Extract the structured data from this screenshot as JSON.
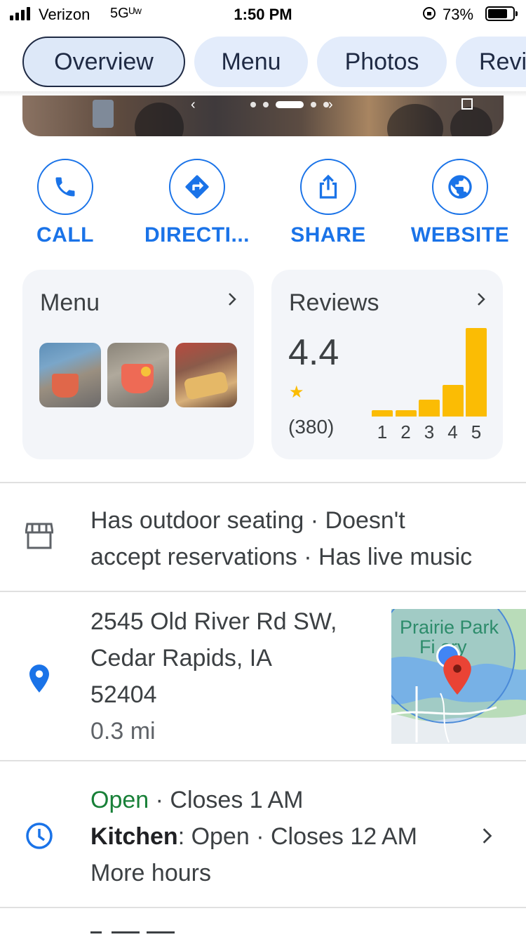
{
  "status_bar": {
    "carrier": "Verizon",
    "network": "5Gᵁʷ",
    "time": "1:50 PM",
    "battery_pct": "73%",
    "battery_level": 0.73
  },
  "tabs": [
    {
      "label": "Overview",
      "active": true
    },
    {
      "label": "Menu",
      "active": false
    },
    {
      "label": "Photos",
      "active": false
    },
    {
      "label": "Revi",
      "active": false
    }
  ],
  "photo_carousel": {
    "dots": 6,
    "active_index": 2
  },
  "actions": [
    {
      "label": "CALL",
      "icon": "phone-icon"
    },
    {
      "label": "DIRECTI...",
      "icon": "directions-icon"
    },
    {
      "label": "SHARE",
      "icon": "share-icon"
    },
    {
      "label": "WEBSITE",
      "icon": "globe-icon"
    }
  ],
  "menu_card": {
    "title": "Menu",
    "thumbnails": [
      "drink-photo",
      "cocktail-photo",
      "food-photo"
    ]
  },
  "reviews_card": {
    "title": "Reviews",
    "rating": "4.4",
    "stars": 1,
    "count": "(380)",
    "bar_labels": [
      "1",
      "2",
      "3",
      "4",
      "5"
    ],
    "distribution": [
      0.07,
      0.07,
      0.19,
      0.36,
      1.0
    ]
  },
  "attributes": {
    "line1": "Has outdoor seating · Doesn't",
    "line2": "accept reservations · Has live music"
  },
  "address": {
    "line1": "2545 Old River Rd SW,",
    "line2": "Cedar Rapids, IA",
    "line3": "52404",
    "distance": "0.3 mi",
    "map_label_line1": "Prairie Park",
    "map_label_line2": "Fi   ery"
  },
  "hours": {
    "status": "Open",
    "closes": " · Closes 1 AM",
    "kitchen_label": "Kitchen",
    "kitchen_rest": ": Open · Closes 12 AM",
    "more": "More hours"
  },
  "colors": {
    "accent": "#1a73e8",
    "open_green": "#188038",
    "star": "#fbbc04",
    "map_pin": "#ea4335"
  }
}
